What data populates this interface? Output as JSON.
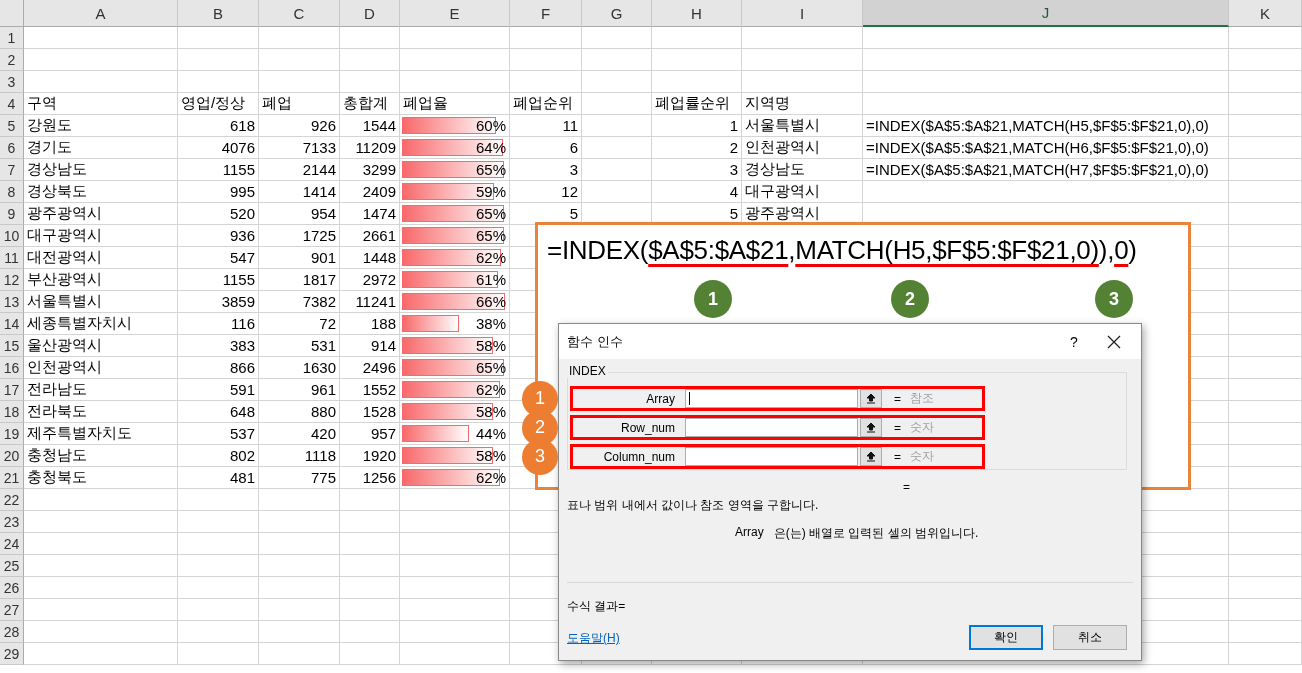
{
  "sheet": {
    "columns": [
      {
        "label": "A",
        "selected": false
      },
      {
        "label": "B",
        "selected": false
      },
      {
        "label": "C",
        "selected": false
      },
      {
        "label": "D",
        "selected": false
      },
      {
        "label": "E",
        "selected": false
      },
      {
        "label": "F",
        "selected": false
      },
      {
        "label": "G",
        "selected": false
      },
      {
        "label": "H",
        "selected": false
      },
      {
        "label": "I",
        "selected": false
      },
      {
        "label": "J",
        "selected": true
      },
      {
        "label": "K",
        "selected": false
      }
    ],
    "rows": [
      {
        "number": "1",
        "kind": "empty"
      },
      {
        "number": "2",
        "kind": "empty"
      },
      {
        "number": "3",
        "kind": "empty"
      },
      {
        "number": "4",
        "kind": "header",
        "cells": [
          "구역",
          "영업/정상",
          "폐업",
          "총합계",
          "폐업율",
          "폐업순위",
          null,
          "폐업률순위",
          "지역명"
        ]
      },
      {
        "number": "5",
        "kind": "data",
        "level": 0.92,
        "cells": [
          "강원도",
          "618",
          "926",
          "1544",
          "60%",
          "11",
          null,
          "1",
          "서울특별시",
          "=INDEX($A$5:$A$21,MATCH(H5,$F$5:$F$21,0),0)"
        ]
      },
      {
        "number": "6",
        "kind": "data",
        "level": 0.98,
        "cells": [
          "경기도",
          "4076",
          "7133",
          "11209",
          "64%",
          "6",
          null,
          "2",
          "인천광역시",
          "=INDEX($A$5:$A$21,MATCH(H6,$F$5:$F$21,0),0)"
        ]
      },
      {
        "number": "7",
        "kind": "data",
        "level": 0.99,
        "cells": [
          "경상남도",
          "1155",
          "2144",
          "3299",
          "65%",
          "3",
          null,
          "3",
          "경상남도",
          "=INDEX($A$5:$A$21,MATCH(H7,$F$5:$F$21,0),0)"
        ]
      },
      {
        "number": "8",
        "kind": "data",
        "level": 0.9,
        "cells": [
          "경상북도",
          "995",
          "1414",
          "2409",
          "59%",
          "12",
          null,
          "4",
          "대구광역시"
        ]
      },
      {
        "number": "9",
        "kind": "data",
        "level": 0.99,
        "cells": [
          "광주광역시",
          "520",
          "954",
          "1474",
          "65%",
          "5",
          null,
          "5",
          "광주광역시"
        ]
      },
      {
        "number": "10",
        "kind": "data",
        "level": 0.99,
        "cells": [
          "대구광역시",
          "936",
          "1725",
          "2661",
          "65%"
        ]
      },
      {
        "number": "11",
        "kind": "data",
        "level": 0.96,
        "cells": [
          "대전광역시",
          "547",
          "901",
          "1448",
          "62%"
        ]
      },
      {
        "number": "12",
        "kind": "data",
        "level": 0.94,
        "cells": [
          "부산광역시",
          "1155",
          "1817",
          "2972",
          "61%"
        ]
      },
      {
        "number": "13",
        "kind": "data",
        "level": 1,
        "cells": [
          "서울특별시",
          "3859",
          "7382",
          "11241",
          "66%"
        ]
      },
      {
        "number": "14",
        "kind": "data",
        "level": 0.58,
        "cells": [
          "세종특별자치시",
          "116",
          "72",
          "188",
          "38%"
        ]
      },
      {
        "number": "15",
        "kind": "data",
        "level": 0.89,
        "cells": [
          "울산광역시",
          "383",
          "531",
          "914",
          "58%"
        ]
      },
      {
        "number": "16",
        "kind": "data",
        "level": 0.99,
        "cells": [
          "인천광역시",
          "866",
          "1630",
          "2496",
          "65%"
        ]
      },
      {
        "number": "17",
        "kind": "data",
        "level": 0.95,
        "cells": [
          "전라남도",
          "591",
          "961",
          "1552",
          "62%"
        ]
      },
      {
        "number": "18",
        "kind": "data",
        "level": 0.89,
        "cells": [
          "전라북도",
          "648",
          "880",
          "1528",
          "58%"
        ]
      },
      {
        "number": "19",
        "kind": "data",
        "level": 0.67,
        "cells": [
          "제주특별자치도",
          "537",
          "420",
          "957",
          "44%"
        ]
      },
      {
        "number": "20",
        "kind": "data",
        "level": 0.89,
        "cells": [
          "충청남도",
          "802",
          "1118",
          "1920",
          "58%"
        ]
      },
      {
        "number": "21",
        "kind": "data",
        "level": 0.95,
        "cells": [
          "충청북도",
          "481",
          "775",
          "1256",
          "62%"
        ]
      },
      {
        "number": "22",
        "kind": "empty"
      },
      {
        "number": "23",
        "kind": "empty"
      },
      {
        "number": "24",
        "kind": "empty"
      },
      {
        "number": "25",
        "kind": "empty"
      },
      {
        "number": "26",
        "kind": "empty"
      },
      {
        "number": "27",
        "kind": "empty"
      },
      {
        "number": "28",
        "kind": "empty"
      },
      {
        "number": "29",
        "kind": "empty"
      }
    ]
  },
  "callout": {
    "segments": [
      {
        "text": "=INDEX(",
        "underlined": false
      },
      {
        "text": "$A$5:$A$21",
        "underlined": true
      },
      {
        "text": ",",
        "underlined": false
      },
      {
        "text": "MATCH(H5,$F$5:$F$21,0)",
        "underlined": true
      },
      {
        "text": "),",
        "underlined": false
      },
      {
        "text": "0",
        "underlined": true
      },
      {
        "text": ")",
        "underlined": false
      }
    ],
    "markers": [
      "1",
      "2",
      "3"
    ]
  },
  "dialog": {
    "title": "함수 인수",
    "help": "?",
    "group": "INDEX",
    "args": [
      {
        "marker": "1",
        "label": "Array",
        "focused": true,
        "equals": "=",
        "hint": "참조"
      },
      {
        "marker": "2",
        "label": "Row_num",
        "focused": false,
        "equals": "=",
        "hint": "숫자"
      },
      {
        "marker": "3",
        "label": "Column_num",
        "focused": false,
        "equals": "=",
        "hint": "숫자"
      }
    ],
    "result_equals": "=",
    "description": "표나 범위 내에서 값이나 참조 영역을 구합니다.",
    "arg_name": "Array",
    "arg_description": "은(는) 배열로 입력된 셀의 범위입니다.",
    "formula_result": "수식 결과=",
    "help_link": "도움말(H)",
    "buttons": [
      {
        "label": "확인",
        "default": true
      },
      {
        "label": "취소",
        "default": false
      }
    ]
  }
}
